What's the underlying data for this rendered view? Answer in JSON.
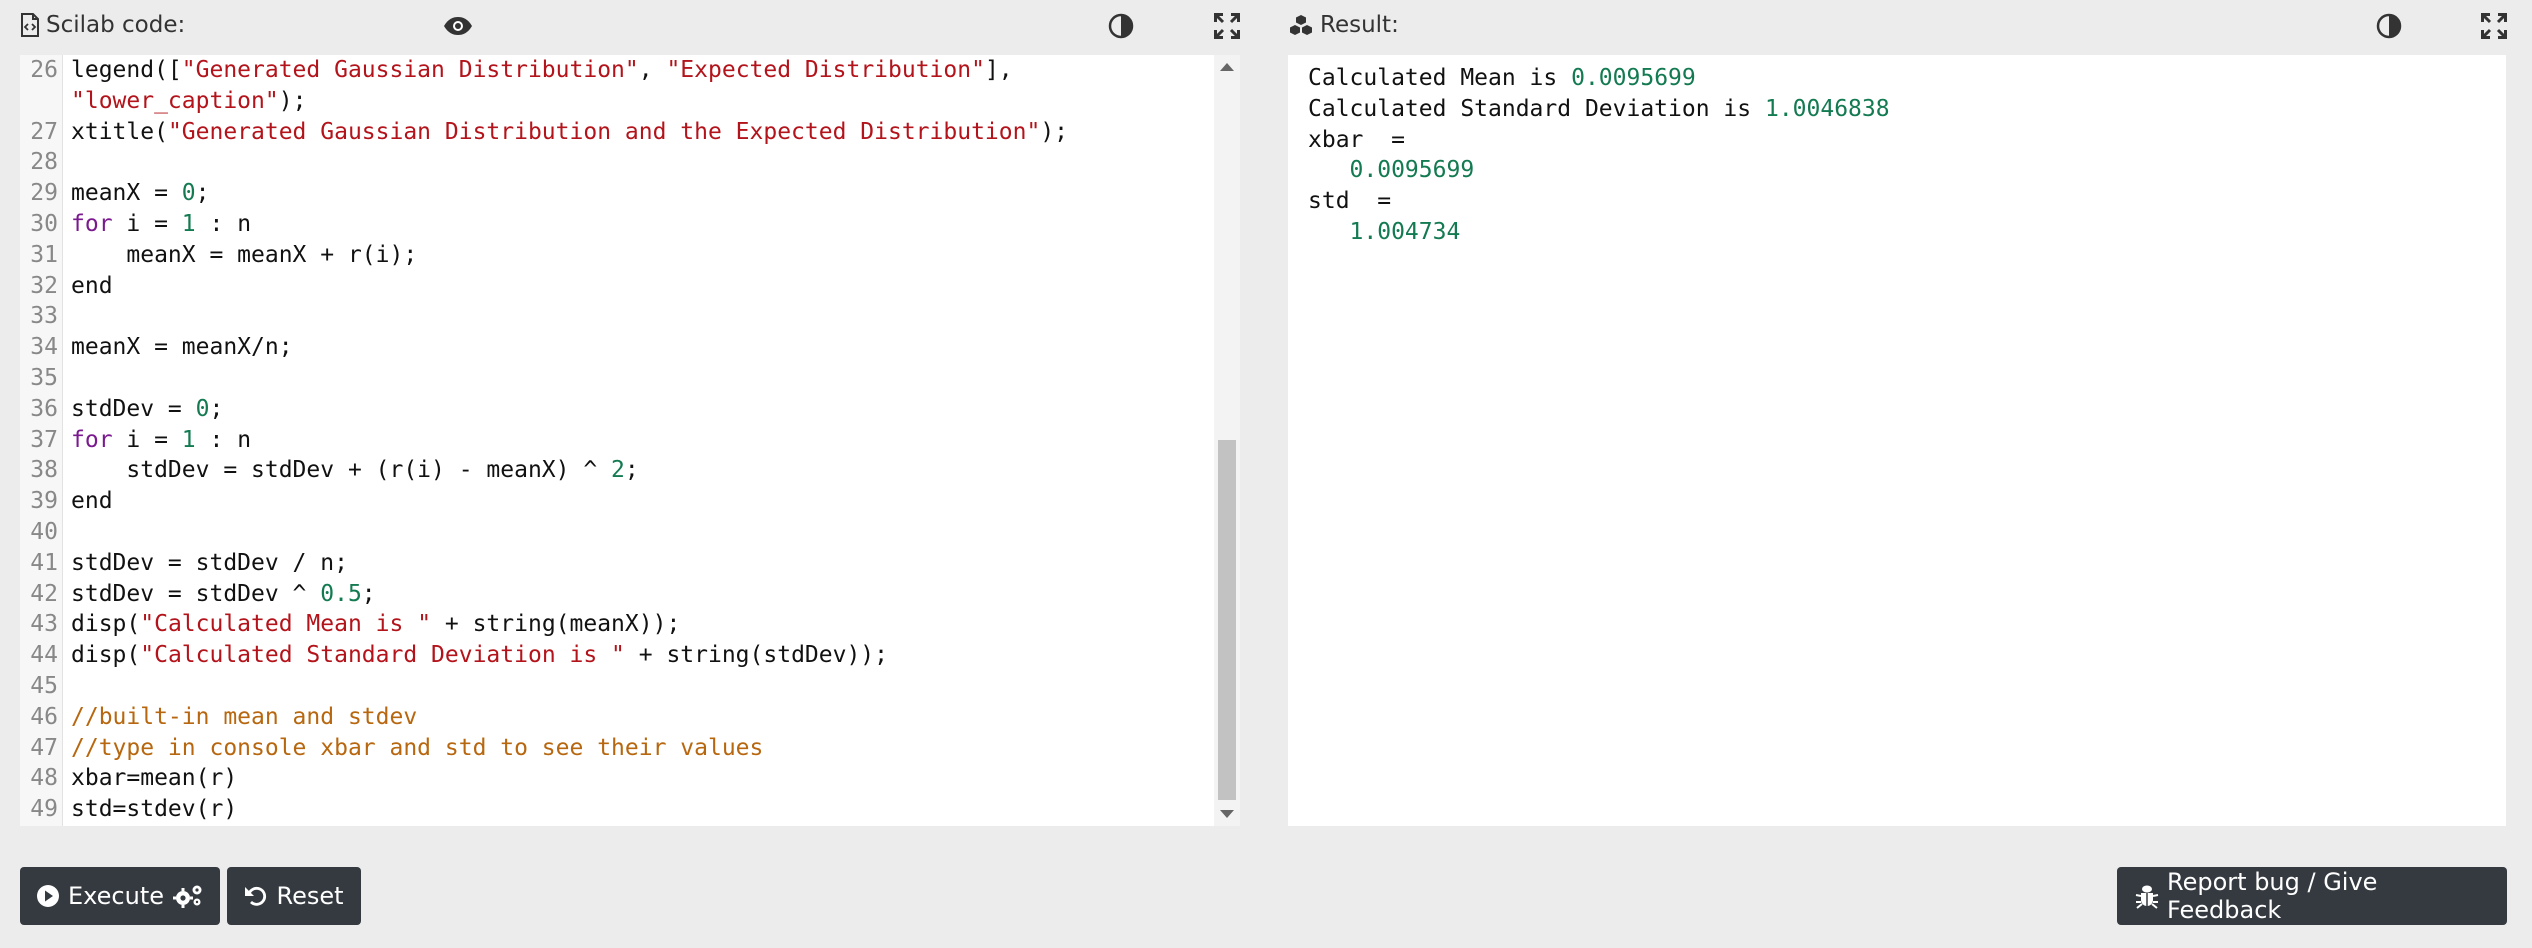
{
  "code_panel": {
    "title": "Scilab code:"
  },
  "result_panel": {
    "title": "Result:"
  },
  "code_lines": [
    {
      "n": "26",
      "segs": [
        {
          "c": "txt",
          "t": "legend(["
        },
        {
          "c": "str",
          "t": "\"Generated Gaussian Distribution\""
        },
        {
          "c": "txt",
          "t": ", "
        },
        {
          "c": "str",
          "t": "\"Expected Distribution\""
        },
        {
          "c": "txt",
          "t": "],"
        }
      ]
    },
    {
      "n": "",
      "segs": [
        {
          "c": "str",
          "t": "\"lower_caption\""
        },
        {
          "c": "txt",
          "t": ");"
        }
      ]
    },
    {
      "n": "27",
      "segs": [
        {
          "c": "txt",
          "t": "xtitle("
        },
        {
          "c": "str",
          "t": "\"Generated Gaussian Distribution and the Expected Distribution\""
        },
        {
          "c": "txt",
          "t": ");"
        }
      ]
    },
    {
      "n": "28",
      "segs": []
    },
    {
      "n": "29",
      "segs": [
        {
          "c": "txt",
          "t": "meanX = "
        },
        {
          "c": "num",
          "t": "0"
        },
        {
          "c": "txt",
          "t": ";"
        }
      ]
    },
    {
      "n": "30",
      "segs": [
        {
          "c": "kw",
          "t": "for"
        },
        {
          "c": "txt",
          "t": " i = "
        },
        {
          "c": "num",
          "t": "1"
        },
        {
          "c": "txt",
          "t": " : n"
        }
      ]
    },
    {
      "n": "31",
      "segs": [
        {
          "c": "txt",
          "t": "    meanX = meanX + r(i);"
        }
      ]
    },
    {
      "n": "32",
      "segs": [
        {
          "c": "txt",
          "t": "end"
        }
      ]
    },
    {
      "n": "33",
      "segs": []
    },
    {
      "n": "34",
      "segs": [
        {
          "c": "txt",
          "t": "meanX = meanX/n;"
        }
      ]
    },
    {
      "n": "35",
      "segs": []
    },
    {
      "n": "36",
      "segs": [
        {
          "c": "txt",
          "t": "stdDev = "
        },
        {
          "c": "num",
          "t": "0"
        },
        {
          "c": "txt",
          "t": ";"
        }
      ]
    },
    {
      "n": "37",
      "segs": [
        {
          "c": "kw",
          "t": "for"
        },
        {
          "c": "txt",
          "t": " i = "
        },
        {
          "c": "num",
          "t": "1"
        },
        {
          "c": "txt",
          "t": " : n"
        }
      ]
    },
    {
      "n": "38",
      "segs": [
        {
          "c": "txt",
          "t": "    stdDev = stdDev + (r(i) - meanX) ^ "
        },
        {
          "c": "num",
          "t": "2"
        },
        {
          "c": "txt",
          "t": ";"
        }
      ]
    },
    {
      "n": "39",
      "segs": [
        {
          "c": "txt",
          "t": "end"
        }
      ]
    },
    {
      "n": "40",
      "segs": []
    },
    {
      "n": "41",
      "segs": [
        {
          "c": "txt",
          "t": "stdDev = stdDev / n;"
        }
      ]
    },
    {
      "n": "42",
      "segs": [
        {
          "c": "txt",
          "t": "stdDev = stdDev ^ "
        },
        {
          "c": "num",
          "t": "0.5"
        },
        {
          "c": "txt",
          "t": ";"
        }
      ]
    },
    {
      "n": "43",
      "segs": [
        {
          "c": "txt",
          "t": "disp("
        },
        {
          "c": "str",
          "t": "\"Calculated Mean is \""
        },
        {
          "c": "txt",
          "t": " + string(meanX));"
        }
      ]
    },
    {
      "n": "44",
      "segs": [
        {
          "c": "txt",
          "t": "disp("
        },
        {
          "c": "str",
          "t": "\"Calculated Standard Deviation is \""
        },
        {
          "c": "txt",
          "t": " + string(stdDev));"
        }
      ]
    },
    {
      "n": "45",
      "segs": []
    },
    {
      "n": "46",
      "segs": [
        {
          "c": "cmt",
          "t": "//built-in mean and stdev"
        }
      ]
    },
    {
      "n": "47",
      "segs": [
        {
          "c": "cmt",
          "t": "//type in console xbar and std to see their values"
        }
      ]
    },
    {
      "n": "48",
      "segs": [
        {
          "c": "txt",
          "t": "xbar=mean(r)"
        }
      ]
    },
    {
      "n": "49",
      "segs": [
        {
          "c": "txt",
          "t": "std=stdev(r)"
        }
      ]
    }
  ],
  "result_lines": [
    {
      "segs": [
        {
          "c": "txt",
          "t": "Calculated Mean is "
        },
        {
          "c": "rnum",
          "t": "0.0095699"
        }
      ]
    },
    {
      "segs": [
        {
          "c": "txt",
          "t": "Calculated Standard Deviation is "
        },
        {
          "c": "rnum",
          "t": "1.0046838"
        }
      ]
    },
    {
      "segs": [
        {
          "c": "txt",
          "t": "xbar  ="
        }
      ]
    },
    {
      "segs": [
        {
          "c": "rnum",
          "t": "   0.0095699"
        }
      ]
    },
    {
      "segs": [
        {
          "c": "txt",
          "t": "std  ="
        }
      ]
    },
    {
      "segs": [
        {
          "c": "rnum",
          "t": "   1.004734"
        }
      ]
    }
  ],
  "buttons": {
    "execute": "Execute",
    "reset": "Reset",
    "report": "Report bug / Give Feedback"
  },
  "icons": {
    "code_file": "file-code-icon",
    "preview": "eye-icon",
    "contrast": "contrast-icon",
    "fullscreen": "expand-icon",
    "result": "cubes-icon",
    "execute": "play-circle-icon",
    "execute_extra": "cogs-icon",
    "reset": "undo-icon",
    "report": "bug-icon"
  }
}
